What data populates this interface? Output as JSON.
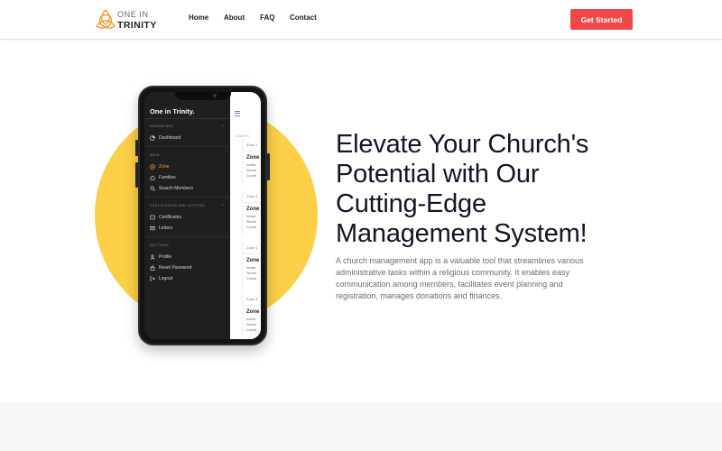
{
  "header": {
    "logo_line1": "ONE IN",
    "logo_line2": "TRINITY",
    "nav": [
      "Home",
      "About",
      "FAQ",
      "Contact"
    ],
    "cta_label": "Get Started"
  },
  "phone": {
    "app_title": "One in Trinity.",
    "sections": [
      {
        "label": "DASHBOARD",
        "items": [
          {
            "label": "Dashboard",
            "icon": "dashboard-icon",
            "active": false
          }
        ]
      },
      {
        "label": "MAIN",
        "items": [
          {
            "label": "Zone",
            "icon": "zone-icon",
            "active": true
          },
          {
            "label": "Families",
            "icon": "families-icon",
            "active": false
          },
          {
            "label": "Search Members",
            "icon": "search-icon",
            "active": false
          }
        ]
      },
      {
        "label": "CERTIFICATES AND LETTERS",
        "items": [
          {
            "label": "Certificates",
            "icon": "certificate-icon",
            "active": false
          },
          {
            "label": "Letters",
            "icon": "letter-icon",
            "active": false
          }
        ]
      },
      {
        "label": "SETTINGS",
        "items": [
          {
            "label": "Profile",
            "icon": "profile-icon",
            "active": false
          },
          {
            "label": "Reset Password",
            "icon": "lock-icon",
            "active": false
          },
          {
            "label": "Logout",
            "icon": "logout-icon",
            "active": false
          }
        ]
      }
    ],
    "content_label": "COUNTS",
    "cards": [
      {
        "top": "Zone 1",
        "title": "Zone",
        "lines": [
          "Inchar",
          "Secret",
          "Coordi"
        ]
      },
      {
        "top": "Zone 1",
        "title": "Zone",
        "lines": [
          "Inchar",
          "Secret",
          "Coordi"
        ]
      },
      {
        "top": "Zone 1",
        "title": "Zone",
        "lines": [
          "Inchar",
          "Secret",
          "Coordi"
        ]
      },
      {
        "top": "Zone 1",
        "title": "Zone",
        "lines": [
          "Inchar",
          "Secret",
          "Coordi"
        ]
      }
    ]
  },
  "hero": {
    "headline_lines": [
      "Elevate Your Church's",
      "Potential with Our",
      "Cutting-Edge",
      "Management System!"
    ],
    "description": "A church management app is a valuable tool that streamlines various administrative tasks within a religious community. It enables easy communication among members, facilitates event planning and registration, manages donations and finances."
  },
  "colors": {
    "accent_red": "#f04747",
    "circle_yellow": "#fbcf47",
    "active_orange": "#f0a23c",
    "logo_gold": "#e8a33c"
  }
}
